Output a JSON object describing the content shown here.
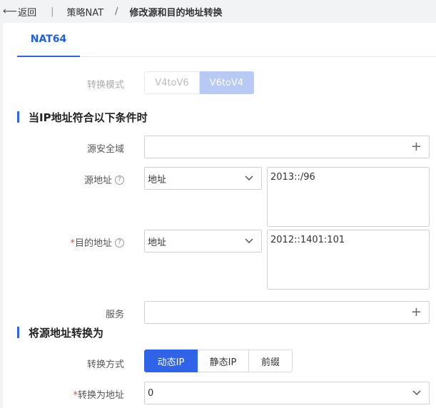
{
  "breadcrumb": {
    "back": "返回",
    "separator1": "|",
    "parent": "策略NAT",
    "separator2": "/",
    "current": "修改源和目的地址转换"
  },
  "tabs": [
    {
      "label": "NAT64",
      "active": true
    }
  ],
  "conversion_mode": {
    "label": "转换模式",
    "options": [
      "V4toV6",
      "V6toV4"
    ],
    "selected": "V6toV4"
  },
  "condition_section": {
    "title": "当IP地址符合以下条件时",
    "source_zone": {
      "label": "源安全域",
      "value": ""
    },
    "source_address": {
      "label": "源地址",
      "help": "?",
      "type": "地址",
      "value": "2013::/96"
    },
    "dest_address": {
      "required_mark": "*",
      "label": "目的地址",
      "help": "?",
      "type": "地址",
      "value": "2012::1401:101"
    },
    "service": {
      "label": "服务",
      "value": ""
    }
  },
  "translate_section": {
    "title": "将源地址转换为",
    "method": {
      "label": "转换方式",
      "options": [
        "动态IP",
        "静态IP",
        "前缀"
      ],
      "selected": "动态IP"
    },
    "translate_to": {
      "required_mark": "*",
      "label": "转换为地址",
      "value": "0"
    }
  },
  "colors": {
    "primary": "#2f64e8",
    "required": "#e5484d",
    "background": "#f2f3f5"
  }
}
